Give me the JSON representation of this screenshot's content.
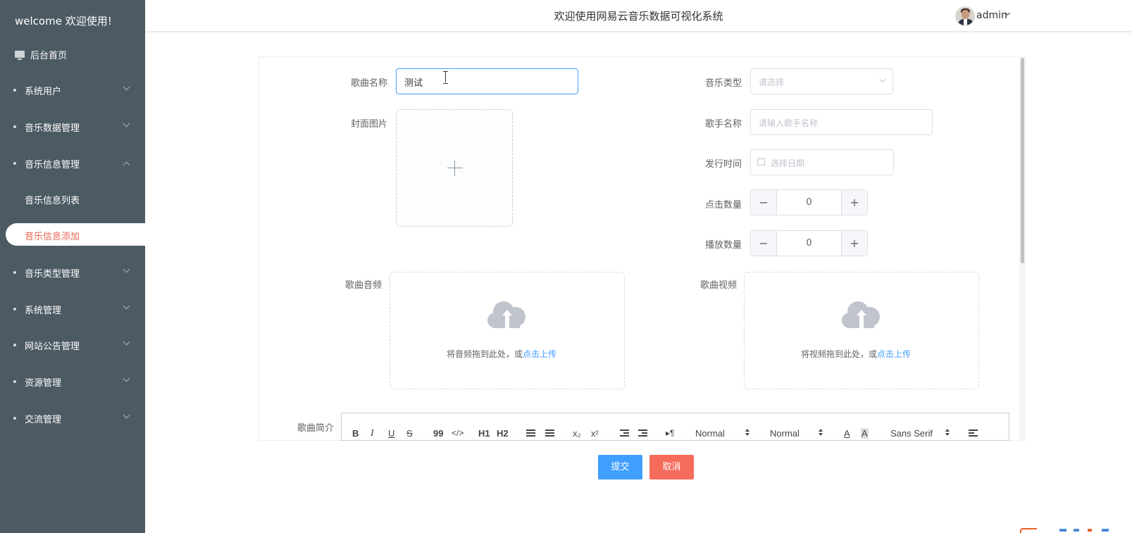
{
  "sidebar": {
    "welcome": "welcome 欢迎使用!",
    "home": "后台首页",
    "items": [
      {
        "label": "系统用户",
        "expanded": false
      },
      {
        "label": "音乐数据管理",
        "expanded": false
      },
      {
        "label": "音乐信息管理",
        "expanded": true
      },
      {
        "label": "音乐类型管理",
        "expanded": false
      },
      {
        "label": "系统管理",
        "expanded": false
      },
      {
        "label": "网站公告管理",
        "expanded": false
      },
      {
        "label": "资源管理",
        "expanded": false
      },
      {
        "label": "交流管理",
        "expanded": false
      }
    ],
    "submenu": [
      {
        "label": "音乐信息列表",
        "active": false
      },
      {
        "label": "音乐信息添加",
        "active": true
      }
    ]
  },
  "header": {
    "title": "欢迎使用网易云音乐数据可视化系统",
    "user": "admin"
  },
  "form": {
    "song_name": {
      "label": "歌曲名称",
      "value": "测试"
    },
    "cover": {
      "label": "封面图片"
    },
    "music_type": {
      "label": "音乐类型",
      "placeholder": "请选择"
    },
    "singer": {
      "label": "歌手名称",
      "placeholder": "请输入歌手名称"
    },
    "release_date": {
      "label": "发行时间",
      "placeholder": "选择日期"
    },
    "click_count": {
      "label": "点击数量",
      "value": "0"
    },
    "play_count": {
      "label": "播放数量",
      "value": "0"
    },
    "audio": {
      "label": "歌曲音频",
      "text": "将音频拖到此处，或",
      "link": "点击上传"
    },
    "video": {
      "label": "歌曲视频",
      "text": "将视频拖到此处，或",
      "link": "点击上传"
    },
    "intro": {
      "label": "歌曲简介"
    }
  },
  "editor_toolbar": {
    "bold": "B",
    "italic": "I",
    "underline": "U",
    "strike": "S",
    "quote": "99",
    "code": "</>",
    "h1": "H1",
    "h2": "H2",
    "sub": "x₂",
    "sup": "x²",
    "rtl": "▸¶",
    "size": "Normal",
    "header": "Normal",
    "font": "Sans Serif",
    "color": "A",
    "background": "A"
  },
  "actions": {
    "submit": "提交",
    "cancel": "取消"
  },
  "colors": {
    "sidebar": "#4c5a63",
    "accent": "#409eff",
    "danger": "#f56c5c",
    "active_text": "#e86452"
  }
}
